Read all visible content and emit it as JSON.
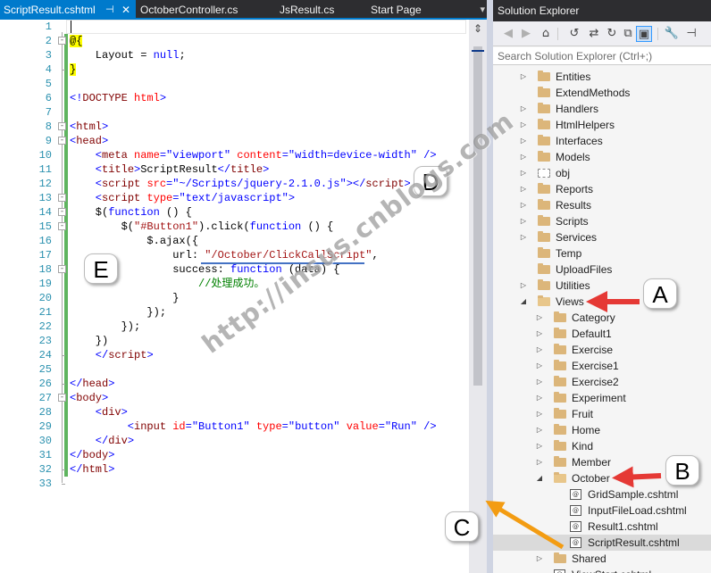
{
  "editor": {
    "tabs": [
      {
        "label": "ScriptResult.cshtml",
        "active": true,
        "pinned": true
      },
      {
        "label": "OctoberController.cs"
      },
      {
        "label": "JsResult.cs"
      },
      {
        "label": "Start Page"
      }
    ],
    "pin_glyph": "⊣",
    "close_glyph": "✕",
    "overflow_glyph": "▾",
    "split_glyph": "⇕",
    "line_numbers": [
      "1",
      "2",
      "3",
      "4",
      "5",
      "6",
      "7",
      "8",
      "9",
      "10",
      "11",
      "12",
      "13",
      "14",
      "15",
      "16",
      "17",
      "18",
      "19",
      "20",
      "21",
      "22",
      "23",
      "24",
      "25",
      "26",
      "27",
      "28",
      "29",
      "30",
      "31",
      "32",
      "33"
    ],
    "fold_markers": [
      "-",
      "-",
      "-",
      "-",
      "-",
      "-",
      "-",
      "-"
    ],
    "code": [
      [],
      [
        {
          "t": "@{",
          "c": "razor"
        }
      ],
      [
        {
          "t": "    Layout = ",
          "c": "plain"
        },
        {
          "t": "null",
          "c": "kw"
        },
        {
          "t": ";",
          "c": "plain"
        }
      ],
      [
        {
          "t": "}",
          "c": "razor"
        }
      ],
      [],
      [
        {
          "t": "<!",
          "c": "kw"
        },
        {
          "t": "DOCTYPE",
          "c": "tag"
        },
        {
          "t": " ",
          "c": "plain"
        },
        {
          "t": "html",
          "c": "attr"
        },
        {
          "t": ">",
          "c": "kw"
        }
      ],
      [],
      [
        {
          "t": "<",
          "c": "kw"
        },
        {
          "t": "html",
          "c": "tag"
        },
        {
          "t": ">",
          "c": "kw"
        }
      ],
      [
        {
          "t": "<",
          "c": "kw"
        },
        {
          "t": "head",
          "c": "tag"
        },
        {
          "t": ">",
          "c": "kw"
        }
      ],
      [
        {
          "t": "    <",
          "c": "kw"
        },
        {
          "t": "meta",
          "c": "tag"
        },
        {
          "t": " ",
          "c": "plain"
        },
        {
          "t": "name",
          "c": "attr"
        },
        {
          "t": "=",
          "c": "kw"
        },
        {
          "t": "\"viewport\"",
          "c": "strb"
        },
        {
          "t": " ",
          "c": "plain"
        },
        {
          "t": "content",
          "c": "attr"
        },
        {
          "t": "=",
          "c": "kw"
        },
        {
          "t": "\"width=device-width\"",
          "c": "strb"
        },
        {
          "t": " />",
          "c": "kw"
        }
      ],
      [
        {
          "t": "    <",
          "c": "kw"
        },
        {
          "t": "title",
          "c": "tag"
        },
        {
          "t": ">",
          "c": "kw"
        },
        {
          "t": "ScriptResult",
          "c": "plain"
        },
        {
          "t": "</",
          "c": "kw"
        },
        {
          "t": "title",
          "c": "tag"
        },
        {
          "t": ">",
          "c": "kw"
        }
      ],
      [
        {
          "t": "    <",
          "c": "kw"
        },
        {
          "t": "script",
          "c": "tag"
        },
        {
          "t": " ",
          "c": "plain"
        },
        {
          "t": "src",
          "c": "attr"
        },
        {
          "t": "=",
          "c": "kw"
        },
        {
          "t": "\"~/Scripts/jquery-2.1.0.js\"",
          "c": "strb"
        },
        {
          "t": "></",
          "c": "kw"
        },
        {
          "t": "script",
          "c": "tag"
        },
        {
          "t": ">",
          "c": "kw"
        }
      ],
      [
        {
          "t": "    <",
          "c": "kw"
        },
        {
          "t": "script",
          "c": "tag"
        },
        {
          "t": " ",
          "c": "plain"
        },
        {
          "t": "type",
          "c": "attr"
        },
        {
          "t": "=",
          "c": "kw"
        },
        {
          "t": "\"text/javascript\"",
          "c": "strb"
        },
        {
          "t": ">",
          "c": "kw"
        }
      ],
      [
        {
          "t": "    $(",
          "c": "plain"
        },
        {
          "t": "function",
          "c": "kw"
        },
        {
          "t": " () {",
          "c": "plain"
        }
      ],
      [
        {
          "t": "        $(",
          "c": "plain"
        },
        {
          "t": "\"#Button1\"",
          "c": "str"
        },
        {
          "t": ").click(",
          "c": "plain"
        },
        {
          "t": "function",
          "c": "kw"
        },
        {
          "t": " () {",
          "c": "plain"
        }
      ],
      [
        {
          "t": "            $.ajax({",
          "c": "plain"
        }
      ],
      [
        {
          "t": "                url: ",
          "c": "plain"
        },
        {
          "t": "\"/October/ClickCallScript\"",
          "c": "url"
        },
        {
          "t": ",",
          "c": "plain"
        }
      ],
      [
        {
          "t": "                success: ",
          "c": "plain"
        },
        {
          "t": "function",
          "c": "kw"
        },
        {
          "t": " (data) {",
          "c": "plain"
        }
      ],
      [
        {
          "t": "                    //处理成功。",
          "c": "comment"
        }
      ],
      [
        {
          "t": "                }",
          "c": "plain"
        }
      ],
      [
        {
          "t": "            });",
          "c": "plain"
        }
      ],
      [
        {
          "t": "        });",
          "c": "plain"
        }
      ],
      [
        {
          "t": "    })",
          "c": "plain"
        }
      ],
      [
        {
          "t": "    </",
          "c": "kw"
        },
        {
          "t": "script",
          "c": "tag"
        },
        {
          "t": ">",
          "c": "kw"
        }
      ],
      [],
      [
        {
          "t": "</",
          "c": "kw"
        },
        {
          "t": "head",
          "c": "tag"
        },
        {
          "t": ">",
          "c": "kw"
        }
      ],
      [
        {
          "t": "<",
          "c": "kw"
        },
        {
          "t": "body",
          "c": "tag"
        },
        {
          "t": ">",
          "c": "kw"
        }
      ],
      [
        {
          "t": "    <",
          "c": "kw"
        },
        {
          "t": "div",
          "c": "tag"
        },
        {
          "t": ">",
          "c": "kw"
        }
      ],
      [
        {
          "t": "         <",
          "c": "kw"
        },
        {
          "t": "input",
          "c": "tag"
        },
        {
          "t": " ",
          "c": "plain"
        },
        {
          "t": "id",
          "c": "attr"
        },
        {
          "t": "=",
          "c": "kw"
        },
        {
          "t": "\"Button1\"",
          "c": "strb"
        },
        {
          "t": " ",
          "c": "plain"
        },
        {
          "t": "type",
          "c": "attr"
        },
        {
          "t": "=",
          "c": "kw"
        },
        {
          "t": "\"button\"",
          "c": "strb"
        },
        {
          "t": " ",
          "c": "plain"
        },
        {
          "t": "value",
          "c": "attr"
        },
        {
          "t": "=",
          "c": "kw"
        },
        {
          "t": "\"Run\"",
          "c": "strb"
        },
        {
          "t": " />",
          "c": "kw"
        }
      ],
      [
        {
          "t": "    </",
          "c": "kw"
        },
        {
          "t": "div",
          "c": "tag"
        },
        {
          "t": ">",
          "c": "kw"
        }
      ],
      [
        {
          "t": "</",
          "c": "kw"
        },
        {
          "t": "body",
          "c": "tag"
        },
        {
          "t": ">",
          "c": "kw"
        }
      ],
      [
        {
          "t": "</",
          "c": "kw"
        },
        {
          "t": "html",
          "c": "tag"
        },
        {
          "t": ">",
          "c": "kw"
        }
      ],
      []
    ]
  },
  "solution_explorer": {
    "title": "Solution Explorer",
    "search_placeholder": "Search Solution Explorer (Ctrl+;)",
    "toolbar_icons": [
      "back-icon",
      "forward-icon",
      "home-icon",
      "history-icon",
      "sync-icon",
      "refresh-icon",
      "collapse-all-icon",
      "show-all-files-icon",
      "properties-icon",
      "pin-icon"
    ],
    "toolbar_glyphs": [
      "◀",
      "▶",
      "⌂",
      "↺",
      "⇄",
      "↻",
      "⧉",
      "▣",
      "🔧",
      "⊣"
    ],
    "items": [
      {
        "label": "Entities",
        "type": "folder",
        "level": 1,
        "expand": "collapsed"
      },
      {
        "label": "ExtendMethods",
        "type": "folder",
        "level": 1,
        "expand": "none"
      },
      {
        "label": "Handlers",
        "type": "folder",
        "level": 1,
        "expand": "collapsed"
      },
      {
        "label": "HtmlHelpers",
        "type": "folder",
        "level": 1,
        "expand": "collapsed"
      },
      {
        "label": "Interfaces",
        "type": "folder",
        "level": 1,
        "expand": "collapsed"
      },
      {
        "label": "Models",
        "type": "folder",
        "level": 1,
        "expand": "collapsed"
      },
      {
        "label": "obj",
        "type": "folder-hidden",
        "level": 1,
        "expand": "collapsed"
      },
      {
        "label": "Reports",
        "type": "folder",
        "level": 1,
        "expand": "collapsed"
      },
      {
        "label": "Results",
        "type": "folder",
        "level": 1,
        "expand": "collapsed"
      },
      {
        "label": "Scripts",
        "type": "folder",
        "level": 1,
        "expand": "collapsed"
      },
      {
        "label": "Services",
        "type": "folder",
        "level": 1,
        "expand": "collapsed"
      },
      {
        "label": "Temp",
        "type": "folder",
        "level": 1,
        "expand": "none"
      },
      {
        "label": "UploadFiles",
        "type": "folder",
        "level": 1,
        "expand": "none"
      },
      {
        "label": "Utilities",
        "type": "folder",
        "level": 1,
        "expand": "collapsed"
      },
      {
        "label": "Views",
        "type": "folder-open",
        "level": 1,
        "expand": "expanded"
      },
      {
        "label": "Category",
        "type": "folder",
        "level": 2,
        "expand": "collapsed"
      },
      {
        "label": "Default1",
        "type": "folder",
        "level": 2,
        "expand": "collapsed"
      },
      {
        "label": "Exercise",
        "type": "folder",
        "level": 2,
        "expand": "collapsed"
      },
      {
        "label": "Exercise1",
        "type": "folder",
        "level": 2,
        "expand": "collapsed"
      },
      {
        "label": "Exercise2",
        "type": "folder",
        "level": 2,
        "expand": "collapsed"
      },
      {
        "label": "Experiment",
        "type": "folder",
        "level": 2,
        "expand": "collapsed"
      },
      {
        "label": "Fruit",
        "type": "folder",
        "level": 2,
        "expand": "collapsed"
      },
      {
        "label": "Home",
        "type": "folder",
        "level": 2,
        "expand": "collapsed"
      },
      {
        "label": "Kind",
        "type": "folder",
        "level": 2,
        "expand": "collapsed"
      },
      {
        "label": "Member",
        "type": "folder",
        "level": 2,
        "expand": "collapsed"
      },
      {
        "label": "October",
        "type": "folder-open",
        "level": 2,
        "expand": "expanded"
      },
      {
        "label": "GridSample.cshtml",
        "type": "file",
        "level": 3,
        "expand": "none"
      },
      {
        "label": "InputFileLoad.cshtml",
        "type": "file",
        "level": 3,
        "expand": "none"
      },
      {
        "label": "Result1.cshtml",
        "type": "file",
        "level": 3,
        "expand": "none"
      },
      {
        "label": "ScriptResult.cshtml",
        "type": "file",
        "level": 3,
        "expand": "none",
        "highlighted": true
      },
      {
        "label": "Shared",
        "type": "folder",
        "level": 2,
        "expand": "collapsed"
      },
      {
        "label": "ViewStart.cshtml",
        "type": "file",
        "level": 2,
        "expand": "none"
      }
    ],
    "file_icon_glyph": "[@]"
  },
  "annotations": {
    "callouts": [
      "A",
      "B",
      "C",
      "D",
      "E"
    ],
    "watermark": "http://insus.cnblogs.com"
  },
  "colors": {
    "accent": "#007acc",
    "arrow_red": "#e53935",
    "arrow_orange": "#f39c12",
    "underline_blue": "#4472c4"
  }
}
